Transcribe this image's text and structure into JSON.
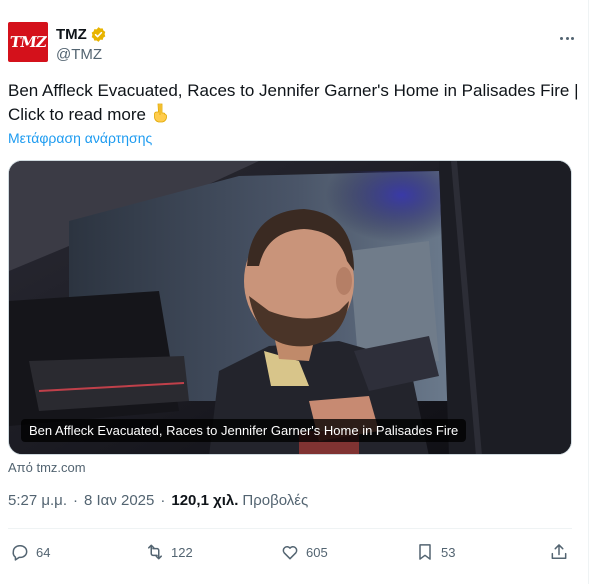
{
  "tweet": {
    "author": {
      "display_name": "TMZ",
      "handle": "@TMZ",
      "avatar_text": "TMZ",
      "verified": true,
      "verified_color": "#e8b400"
    },
    "text": "Ben Affleck Evacuated, Races to Jennifer Garner's Home in Palisades Fire | Click to read more",
    "emoji": "👇",
    "translate_label": "Μετάφραση ανάρτησης",
    "media": {
      "caption": "Ben Affleck Evacuated, Races to Jennifer Garner's Home in Palisades Fire"
    },
    "source": "Από tmz.com",
    "timestamp": {
      "time": "5:27 μ.μ.",
      "date": "8 Ιαν 2025",
      "views": "120,1 χιλ.",
      "views_label": "Προβολές"
    },
    "actions": {
      "replies": "64",
      "reposts": "122",
      "likes": "605",
      "bookmarks": "53"
    }
  },
  "colors": {
    "brand_red": "#d4111b",
    "link_blue": "#1d9bf0",
    "secondary_text": "#536471"
  }
}
